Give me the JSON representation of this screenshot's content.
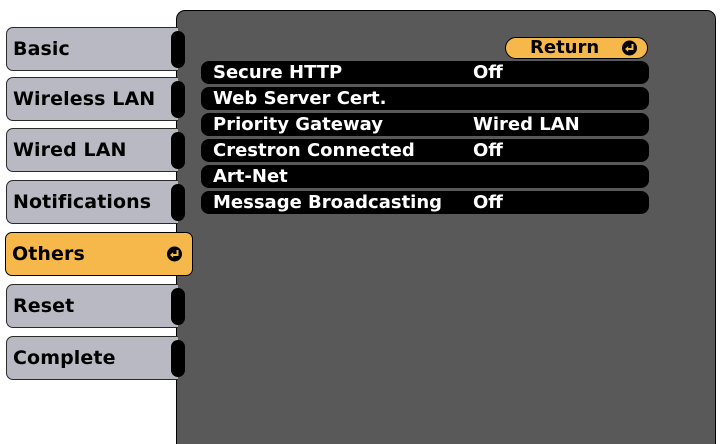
{
  "menu": {
    "items": [
      {
        "label": "Basic"
      },
      {
        "label": "Wireless LAN"
      },
      {
        "label": "Wired LAN"
      },
      {
        "label": "Notifications"
      },
      {
        "label": "Others",
        "selected": true
      },
      {
        "label": "Reset"
      },
      {
        "label": "Complete"
      }
    ],
    "selected_icon": "enter-icon"
  },
  "return_button": {
    "label": "Return",
    "icon": "enter-icon"
  },
  "settings": {
    "rows": [
      {
        "label": "Secure HTTP",
        "value": "Off"
      },
      {
        "label": "Web Server Cert.",
        "value": ""
      },
      {
        "label": "Priority Gateway",
        "value": "Wired LAN"
      },
      {
        "label": "Crestron Connected",
        "value": "Off"
      },
      {
        "label": "Art-Net",
        "value": ""
      },
      {
        "label": "Message Broadcasting",
        "value": "Off"
      }
    ]
  },
  "colors": {
    "panel": "#595959",
    "menu_item": "#b9b9c3",
    "accent": "#f7b84b",
    "row": "#000000",
    "row_text": "#ffffff"
  }
}
